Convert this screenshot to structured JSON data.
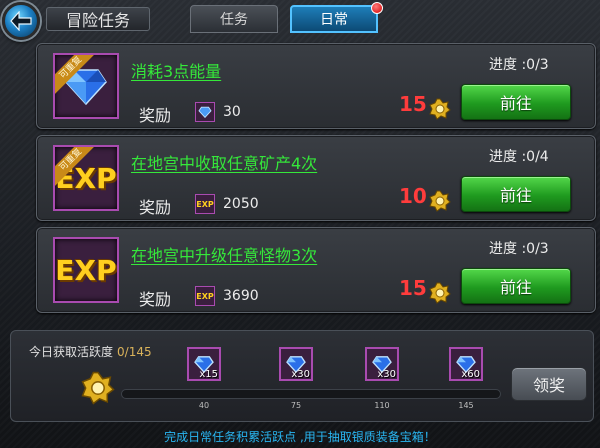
{
  "header": {
    "title": "冒险任务",
    "tabs": [
      {
        "label": "任务",
        "active": false
      },
      {
        "label": "日常",
        "active": true,
        "has_notification": true
      }
    ]
  },
  "tasks": [
    {
      "title": "消耗3点能量",
      "repeatable_tag": "可重复",
      "icon": "blue-diamond-icon",
      "reward_label": "奖励",
      "reward_icon": "blue-diamond-icon",
      "reward_amount": "30",
      "progress": "进度 :0/3",
      "points": "15",
      "button": "前往"
    },
    {
      "title": "在地宫中收取任意矿产4次",
      "repeatable_tag": "可重复",
      "icon": "exp-icon",
      "icon_text": "EXP",
      "reward_label": "奖励",
      "reward_icon": "exp-icon",
      "reward_icon_text": "EXP",
      "reward_amount": "2050",
      "progress": "进度 :0/4",
      "points": "10",
      "button": "前往"
    },
    {
      "title": "在地宫中升级任意怪物3次",
      "icon": "exp-icon",
      "icon_text": "EXP",
      "reward_label": "奖励",
      "reward_icon": "exp-icon",
      "reward_icon_text": "EXP",
      "reward_amount": "3690",
      "progress": "进度 :0/3",
      "points": "15",
      "button": "前往"
    }
  ],
  "activity": {
    "label": "今日获取活跃度",
    "count": "0/145",
    "milestones": [
      {
        "qty": "x15",
        "threshold": "40"
      },
      {
        "qty": "x30",
        "threshold": "75"
      },
      {
        "qty": "x30",
        "threshold": "110"
      },
      {
        "qty": "x60",
        "threshold": "145"
      }
    ],
    "claim_button": "领奖"
  },
  "footer_hint": "完成日常任务积累活跃点 ,用于抽取银质装备宝箱！",
  "colors": {
    "task_title": "#35e83a",
    "points": "#ff3c3c",
    "go_button": "#1f9a1f",
    "active_tab": "#1e7db8",
    "hint": "#29b6f2"
  }
}
